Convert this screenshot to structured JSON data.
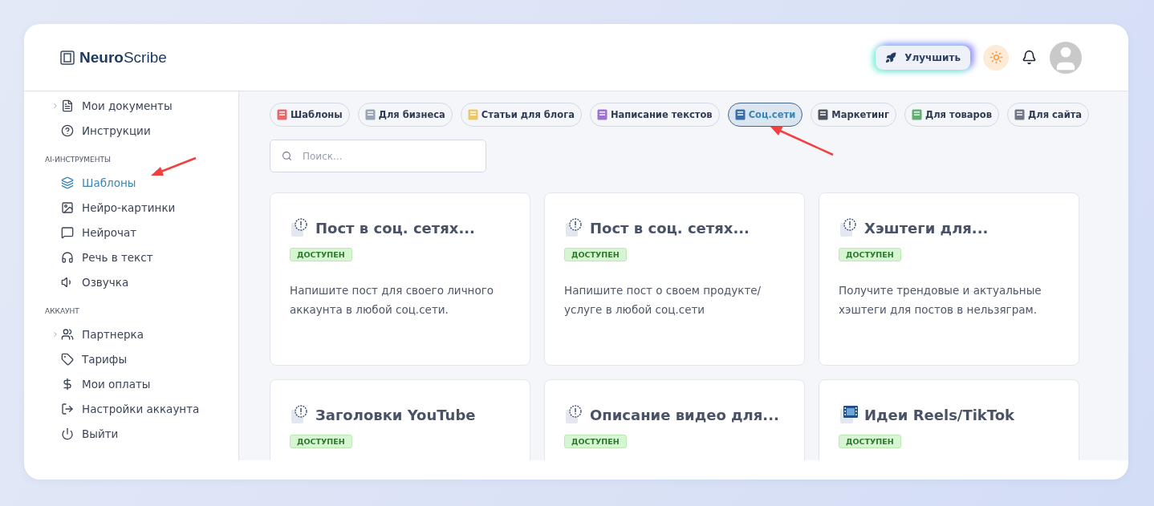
{
  "logo": {
    "bold": "Neuro",
    "light": "Scribe"
  },
  "header": {
    "upgrade": "Улучшить"
  },
  "sidebar": {
    "top_items": [
      {
        "label": "Мои документы",
        "expandable": true,
        "selected": false
      },
      {
        "label": "Инструкции",
        "expandable": false,
        "selected": false
      }
    ],
    "sections": [
      {
        "title": "AI-ИНСТРУМЕНТЫ",
        "items": [
          {
            "label": "Шаблоны",
            "expandable": false,
            "selected": true
          },
          {
            "label": "Нейро-картинки",
            "expandable": false,
            "selected": false
          },
          {
            "label": "Нейрочат",
            "expandable": false,
            "selected": false
          },
          {
            "label": "Речь в текст",
            "expandable": false,
            "selected": false
          },
          {
            "label": "Озвучка",
            "expandable": false,
            "selected": false
          }
        ]
      },
      {
        "title": "АККАУНТ",
        "items": [
          {
            "label": "Партнерка",
            "expandable": true,
            "selected": false
          },
          {
            "label": "Тарифы",
            "expandable": false,
            "selected": false
          },
          {
            "label": "Мои оплаты",
            "expandable": false,
            "selected": false
          },
          {
            "label": "Настройки аккаунта",
            "expandable": false,
            "selected": false
          },
          {
            "label": "Выйти",
            "expandable": false,
            "selected": false
          }
        ]
      }
    ]
  },
  "categories": [
    {
      "label": "Шаблоны",
      "selected": false
    },
    {
      "label": "Для бизнеса",
      "selected": false
    },
    {
      "label": "Статьи для блога",
      "selected": false
    },
    {
      "label": "Написание текстов",
      "selected": false
    },
    {
      "label": "Соц.сети",
      "selected": true
    },
    {
      "label": "Маркетинг",
      "selected": false
    },
    {
      "label": "Для товаров",
      "selected": false
    },
    {
      "label": "Для сайта",
      "selected": false
    }
  ],
  "search": {
    "placeholder": "Поиск..."
  },
  "cards": [
    {
      "kind": "info",
      "title": "Пост в соц. сетях...",
      "badge": "ДОСТУПЕН",
      "description": "Напишите пост для своего личного аккаунта в любой соц.сети."
    },
    {
      "kind": "info",
      "title": "Пост в соц. сетях...",
      "badge": "ДОСТУПЕН",
      "description": "Напишите пост о своем продукте/ услуге в любой соц.сети"
    },
    {
      "kind": "info",
      "title": "Хэштеги для...",
      "badge": "ДОСТУПЕН",
      "description": "Получите трендовые и актуальные хэштеги для постов в нельзяграм."
    },
    {
      "kind": "info",
      "title": "Заголовки YouTube",
      "badge": "ДОСТУПЕН"
    },
    {
      "kind": "info",
      "title": "Описание видео для...",
      "badge": "ДОСТУПЕН"
    },
    {
      "kind": "video",
      "title": "Идеи Reels/TikTok",
      "badge": "ДОСТУПЕН"
    }
  ]
}
